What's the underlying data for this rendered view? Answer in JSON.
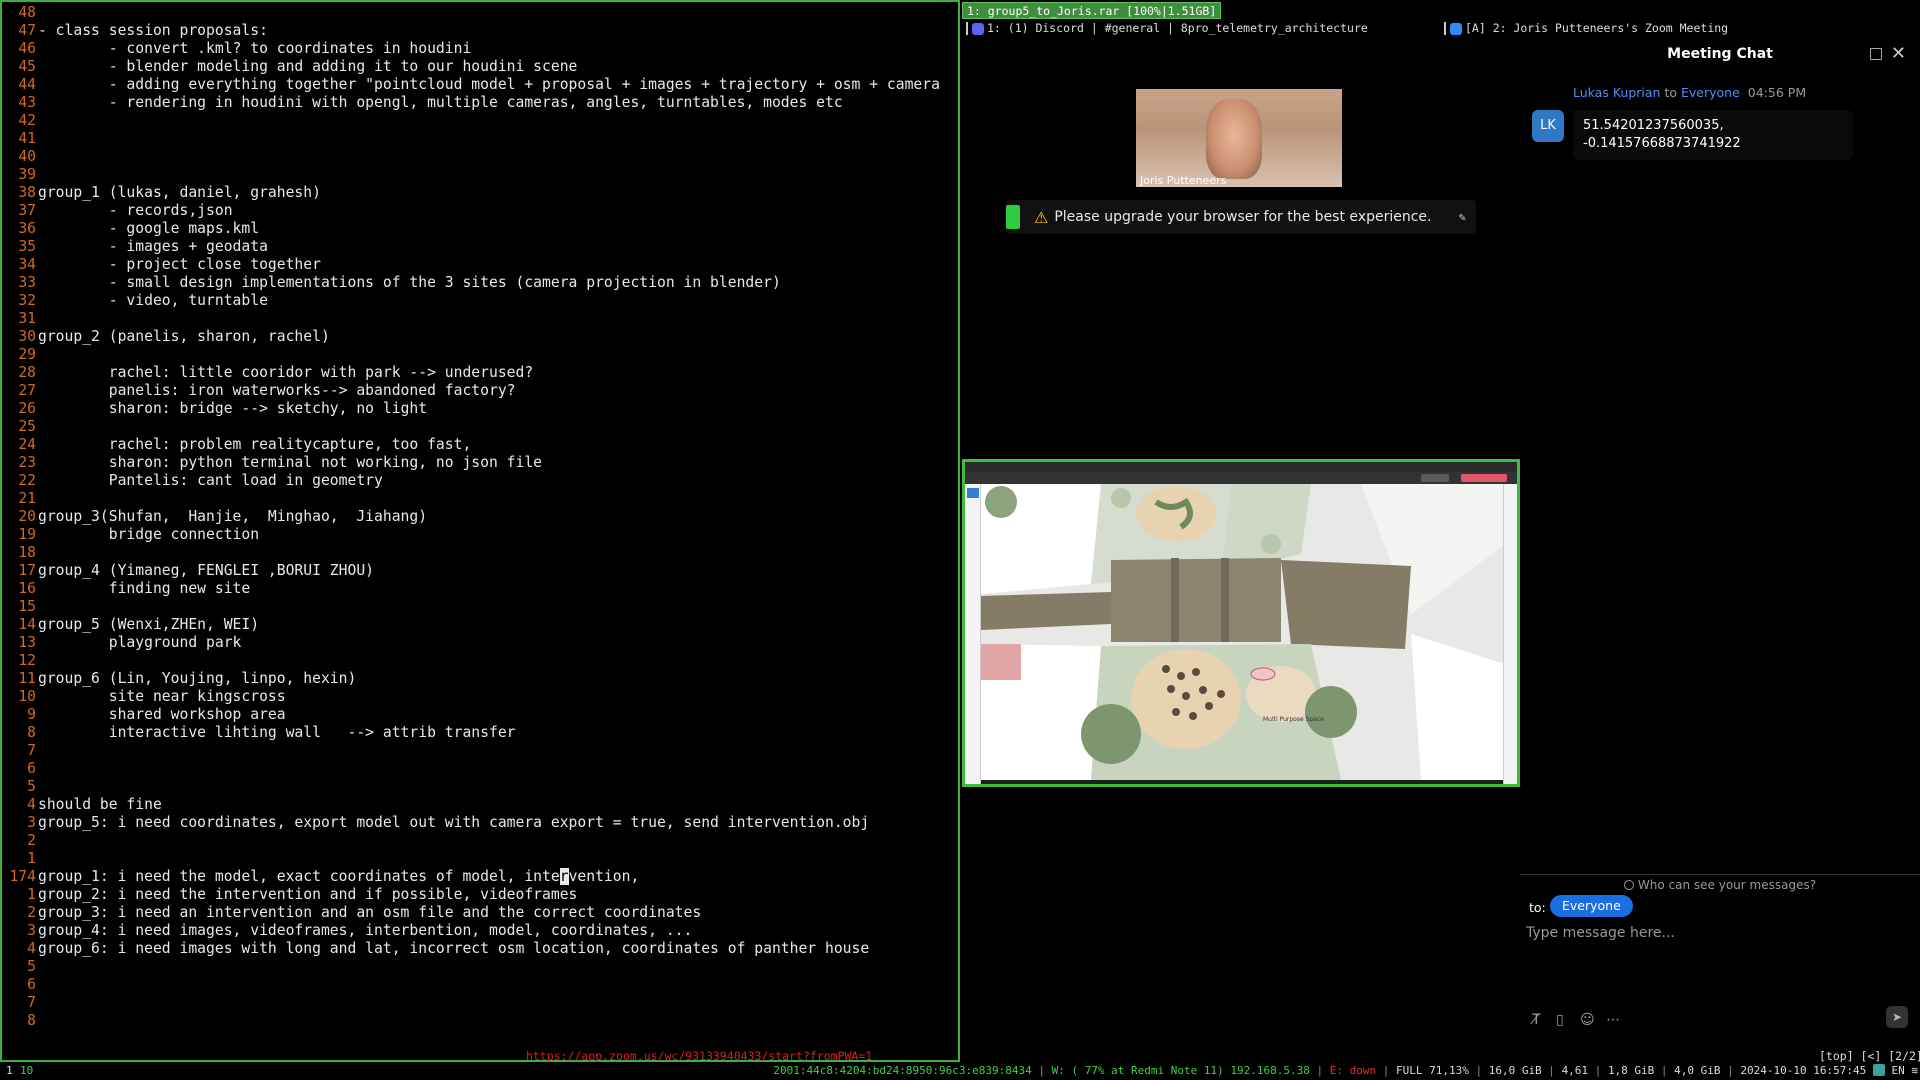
{
  "editor": {
    "lines": [
      {
        "num": "48",
        "text": ""
      },
      {
        "num": "47",
        "text": "- class session proposals:"
      },
      {
        "num": "46",
        "text": "        - convert .kml? to coordinates in houdini"
      },
      {
        "num": "45",
        "text": "        - blender modeling and adding it to our houdini scene"
      },
      {
        "num": "44",
        "text": "        - adding everything together \"pointcloud model + proposal + images + trajectory + osm + camera"
      },
      {
        "num": "43",
        "text": "        - rendering in houdini with opengl, multiple cameras, angles, turntables, modes etc"
      },
      {
        "num": "42",
        "text": ""
      },
      {
        "num": "41",
        "text": ""
      },
      {
        "num": "40",
        "text": ""
      },
      {
        "num": "39",
        "text": ""
      },
      {
        "num": "38",
        "text": "group_1 (lukas, daniel, grahesh)"
      },
      {
        "num": "37",
        "text": "        - records,json"
      },
      {
        "num": "36",
        "text": "        - google maps.kml"
      },
      {
        "num": "35",
        "text": "        - images + geodata"
      },
      {
        "num": "34",
        "text": "        - project close together"
      },
      {
        "num": "33",
        "text": "        - small design implementations of the 3 sites (camera projection in blender)"
      },
      {
        "num": "32",
        "text": "        - video, turntable"
      },
      {
        "num": "31",
        "text": ""
      },
      {
        "num": "30",
        "text": "group_2 (panelis, sharon, rachel)"
      },
      {
        "num": "29",
        "text": ""
      },
      {
        "num": "28",
        "text": "        rachel: little cooridor with park --> underused?"
      },
      {
        "num": "27",
        "text": "        panelis: iron waterworks--> abandoned factory?"
      },
      {
        "num": "26",
        "text": "        sharon: bridge --> sketchy, no light"
      },
      {
        "num": "25",
        "text": ""
      },
      {
        "num": "24",
        "text": "        rachel: problem realitycapture, too fast,"
      },
      {
        "num": "23",
        "text": "        sharon: python terminal not working, no json file"
      },
      {
        "num": "22",
        "text": "        Pantelis: cant load in geometry"
      },
      {
        "num": "21",
        "text": ""
      },
      {
        "num": "20",
        "text": "group_3(Shufan,  Hanjie,  Minghao,  Jiahang)"
      },
      {
        "num": "19",
        "text": "        bridge connection"
      },
      {
        "num": "18",
        "text": ""
      },
      {
        "num": "17",
        "text": "group_4 (Yimaneg, FENGLEI ,BORUI ZHOU)"
      },
      {
        "num": "16",
        "text": "        finding new site"
      },
      {
        "num": "15",
        "text": ""
      },
      {
        "num": "14",
        "text": "group_5 (Wenxi,ZHEn, WEI)"
      },
      {
        "num": "13",
        "text": "        playground park"
      },
      {
        "num": "12",
        "text": ""
      },
      {
        "num": "11",
        "text": "group_6 (Lin, Youjing, linpo, hexin)"
      },
      {
        "num": "10",
        "text": "        site near kingscross"
      },
      {
        "num": "9",
        "text": "        shared workshop area"
      },
      {
        "num": "8",
        "text": "        interactive lihting wall   --> attrib transfer"
      },
      {
        "num": "7",
        "text": ""
      },
      {
        "num": "6",
        "text": ""
      },
      {
        "num": "5",
        "text": ""
      },
      {
        "num": "4",
        "text": "should be fine"
      },
      {
        "num": "3",
        "text": "group_5: i need coordinates, export model out with camera export = true, send intervention.obj"
      },
      {
        "num": "2",
        "text": ""
      },
      {
        "num": "1",
        "text": ""
      },
      {
        "num": "174",
        "text": "group_1: i need the model, exact coordinates of model, inte",
        "cursor": "r",
        "after": "vention,"
      },
      {
        "num": "1",
        "text": "group_2: i need the intervention and if possible, videoframes"
      },
      {
        "num": "2",
        "text": "group_3: i need an intervention and an osm file and the correct coordinates"
      },
      {
        "num": "3",
        "text": "group_4: i need images, videoframes, interbention, model, coordinates, ..."
      },
      {
        "num": "4",
        "text": "group_6: i need images with long and lat, incorrect osm location, coordinates of panther house"
      },
      {
        "num": "5",
        "text": ""
      },
      {
        "num": "6",
        "text": ""
      },
      {
        "num": "7",
        "text": ""
      },
      {
        "num": "8",
        "text": ""
      }
    ]
  },
  "topbar": {
    "active_tab": "1: group5_to_Joris.rar [100%|1.51GB]",
    "discord_window": "1: (1) Discord | #general | 8pro_telemetry_architecture",
    "zoom_window": "[A] 2: Joris Putteneers's Zoom Meeting"
  },
  "zoom": {
    "participant_name": "Joris Putteneers",
    "upgrade_banner": "Please upgrade your browser for the best experience.",
    "url": "https://app.zoom.us/wc/93133940433/start?fromPWA=1",
    "window_flags": "[top] [<] [2/2]",
    "share_labels": {
      "multi_purpose": "Multi Purpose Space"
    }
  },
  "chat": {
    "title": "Meeting Chat",
    "sender": "Lukas Kuprian",
    "to_word": "to",
    "recipient": "Everyone",
    "time": "04:56 PM",
    "avatar_initials": "LK",
    "message_line1": "51.54201237560035,",
    "message_line2": "-0.14157668873741922",
    "who_can_see": "Who can see your messages?",
    "to_label": "to:",
    "to_pill": "Everyone",
    "input_placeholder": "Type message here..."
  },
  "statusbar": {
    "ws1": "1",
    "ws10": "10",
    "ipv6": "2001:44c8:4204:bd24:8950:96c3:e839:8434",
    "wifi": "W: ( 77% at Redmi Note 11) 192.168.5.38",
    "eth": "E: down",
    "battery": "FULL 71,13%",
    "disk": "16,0 GiB",
    "load": "4,61",
    "mem": "1,8 GiB",
    "mem2": "4,0 GiB",
    "datetime": "2024-10-10 16:57:45",
    "lang": "EN"
  },
  "colors": {
    "focus_border": "#3fae3f",
    "line_number": "#d2691e",
    "chat_link": "#4f8ef7",
    "pill_blue": "#1a6fe0",
    "url_red": "#d82020"
  }
}
